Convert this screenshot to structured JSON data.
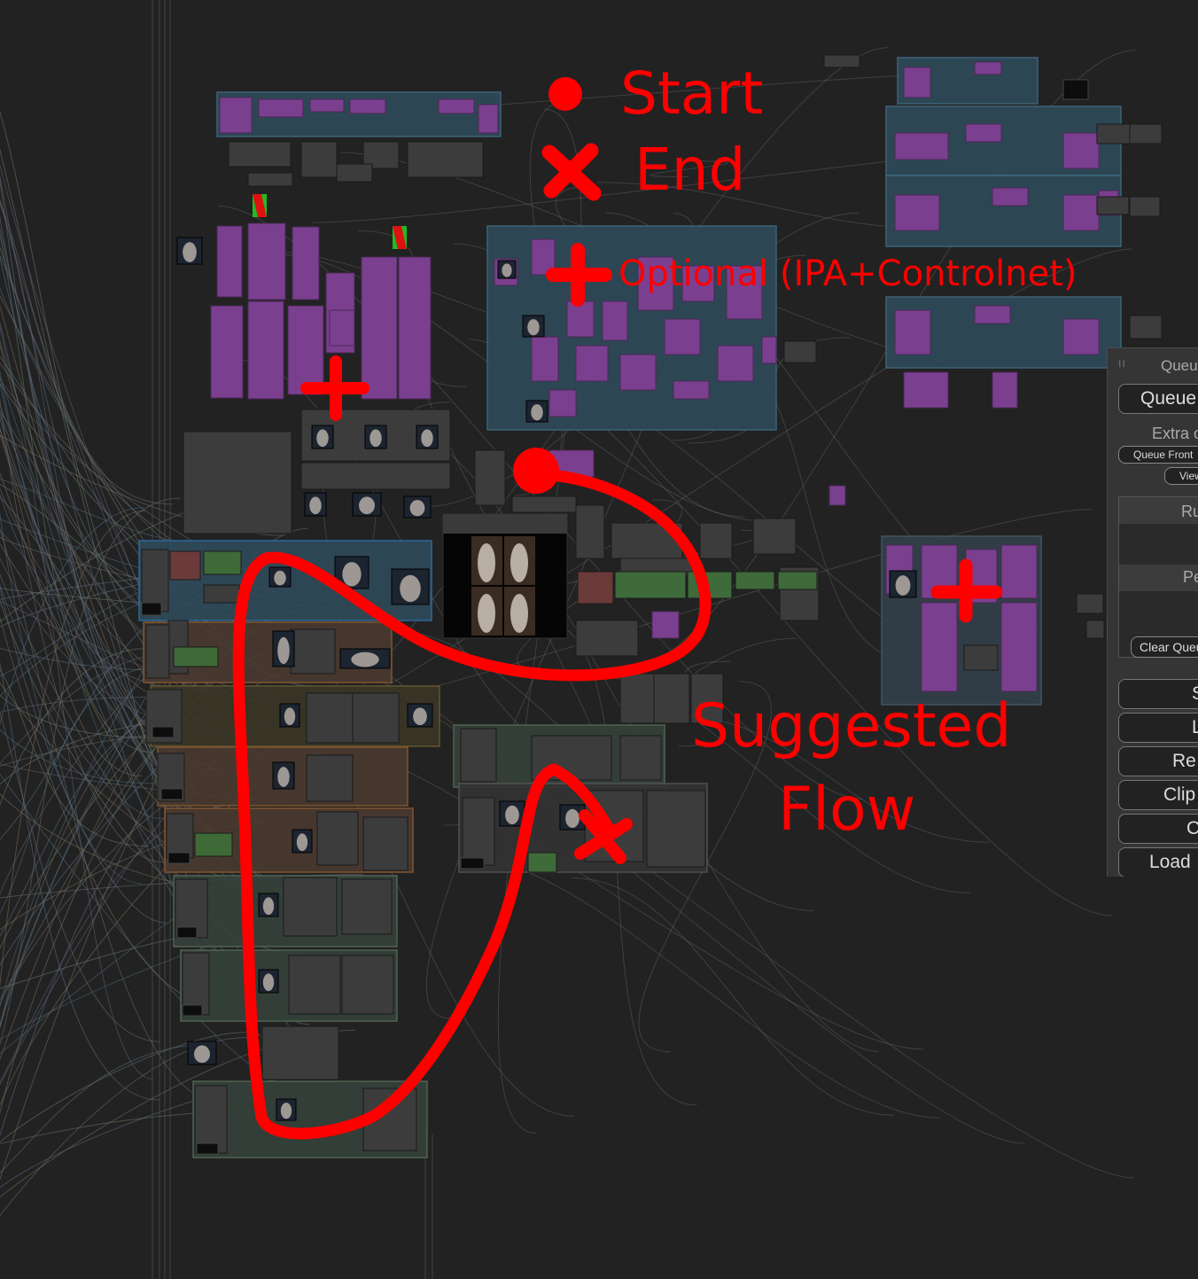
{
  "annotations": {
    "start": "Start",
    "end": "End",
    "optional": "Optional (IPA+Controlnet)",
    "suggested_line1": "Suggested",
    "suggested_line2": "Flow"
  },
  "queue_panel": {
    "title": "Queu",
    "queue_button": "Queue",
    "extra_label": "Extra o",
    "queue_front_button": "Queue Front",
    "view_button": "View",
    "running_label": "Ru",
    "pending_label": "Pe",
    "clear_queue_button": "Clear Queu",
    "buttons": [
      "S",
      "L",
      "Re",
      "Clip",
      "C",
      "Load"
    ]
  },
  "colors": {
    "annotation": "#ff0000",
    "background": "#222222",
    "node_purple": "#7a3f8e",
    "group_teal": "#2f4a5a"
  },
  "icons": {
    "drag_handle": "drag-handle-icon",
    "bypass_toggle": "bypass-indicator-icon"
  }
}
